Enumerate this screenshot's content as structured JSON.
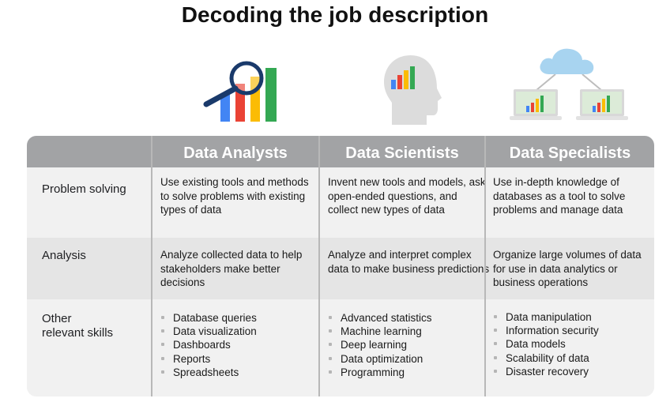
{
  "title": "Decoding the job description",
  "colors": {
    "header_bg": "#a2a3a5",
    "row_light": "#f1f1f1",
    "row_dark": "#e5e5e5",
    "blue": "#4285f4",
    "red": "#ea4335",
    "yellow": "#fbbc04",
    "green": "#34a853",
    "magnifier": "#1a3a6b",
    "head_gray": "#dcdcdc",
    "cloud": "#a8d4f0",
    "laptop_frame": "#d8d8d8",
    "laptop_screen": "#dcebd8"
  },
  "icons": {
    "analysts": "magnifier-bar-chart-icon",
    "scientists": "head-bar-chart-icon",
    "specialists": "cloud-laptops-icon"
  },
  "table": {
    "columns": [
      "",
      "Data Analysts",
      "Data Scientists",
      "Data Specialists"
    ],
    "rows": [
      {
        "label": "Problem solving",
        "analysts": "Use existing tools and methods to solve problems with existing types of data",
        "scientists": "Invent new tools and models, ask open-ended questions, and collect new types of data",
        "specialists": "Use in-depth knowledge of databases as a tool to solve problems and manage data"
      },
      {
        "label": "Analysis",
        "analysts": "Analyze collected data to help stakeholders make better decisions",
        "scientists": "Analyze and interpret complex data to make business predictions",
        "specialists": "Organize large volumes of data for use in data analytics or business operations"
      },
      {
        "label_line1": "Other",
        "label_line2": "relevant skills",
        "analysts": [
          "Database queries",
          "Data visualization",
          "Dashboards",
          "Reports",
          "Spreadsheets"
        ],
        "scientists": [
          "Advanced statistics",
          "Machine learning",
          "Deep learning",
          "Data optimization",
          "Programming"
        ],
        "specialists": [
          "Data manipulation",
          "Information security",
          "Data models",
          "Scalability of data",
          "Disaster recovery"
        ]
      }
    ]
  }
}
